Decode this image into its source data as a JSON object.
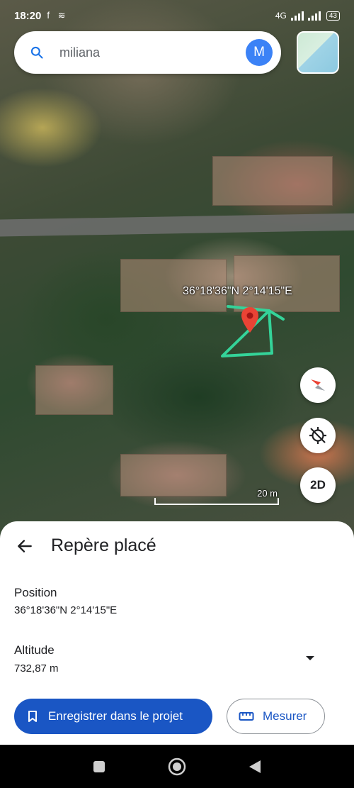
{
  "status_bar": {
    "time": "18:20",
    "network": "4G",
    "battery": "43"
  },
  "search": {
    "query": "miliana",
    "avatar_letter": "M"
  },
  "map": {
    "coordinates_overlay": "36°18'36\"N 2°14'15\"E",
    "scale_label": "20 m",
    "view_mode_button": "2D",
    "polygon_color": "#34d399",
    "marker_color": "#ea4335"
  },
  "sheet": {
    "title": "Repère placé",
    "position_label": "Position",
    "position_value": "36°18'36\"N 2°14'15\"E",
    "altitude_label": "Altitude",
    "altitude_value": "732,87 m",
    "save_button": "Enregistrer dans le projet",
    "measure_button": "Mesurer"
  },
  "colors": {
    "primary": "#1a56c4",
    "avatar": "#3b82f6"
  }
}
